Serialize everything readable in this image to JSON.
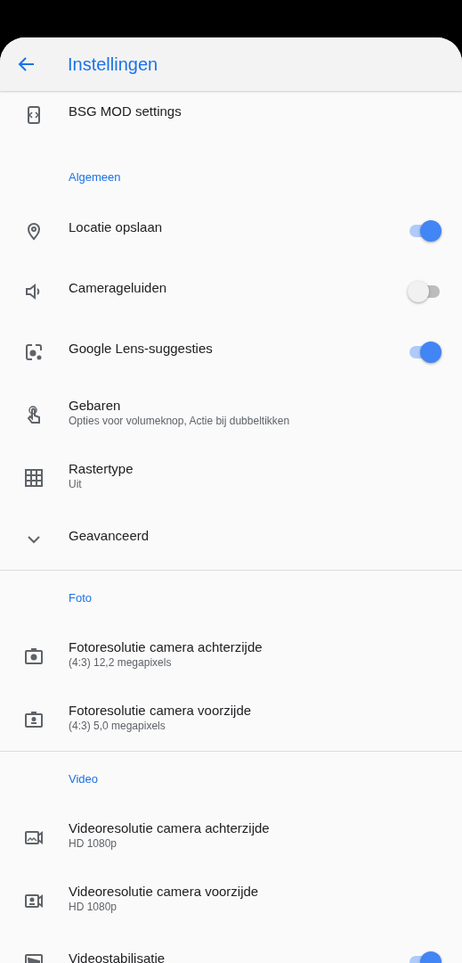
{
  "app_bar": {
    "title": "Instellingen"
  },
  "sections": [
    {
      "items": [
        {
          "title": "BSG MOD settings"
        }
      ]
    },
    {
      "header": "Algemeen",
      "items": [
        {
          "title": "Locatie opslaan",
          "on": true
        },
        {
          "title": "Camerageluiden",
          "on": false
        },
        {
          "title": "Google Lens-suggesties",
          "on": true
        },
        {
          "title": "Gebaren",
          "subtitle": "Opties voor volumeknop, Actie bij dubbeltikken"
        },
        {
          "title": "Rastertype",
          "subtitle": "Uit"
        },
        {
          "title": "Geavanceerd"
        }
      ]
    },
    {
      "header": "Foto",
      "items": [
        {
          "title": "Fotoresolutie camera achterzijde",
          "subtitle": "(4:3) 12,2 megapixels"
        },
        {
          "title": "Fotoresolutie camera voorzijde",
          "subtitle": "(4:3) 5,0 megapixels"
        }
      ]
    },
    {
      "header": "Video",
      "items": [
        {
          "title": "Videoresolutie camera achterzijde",
          "subtitle": "HD 1080p"
        },
        {
          "title": "Videoresolutie camera voorzijde",
          "subtitle": "HD 1080p"
        },
        {
          "title": "Videostabilisatie",
          "on": true
        }
      ]
    }
  ]
}
